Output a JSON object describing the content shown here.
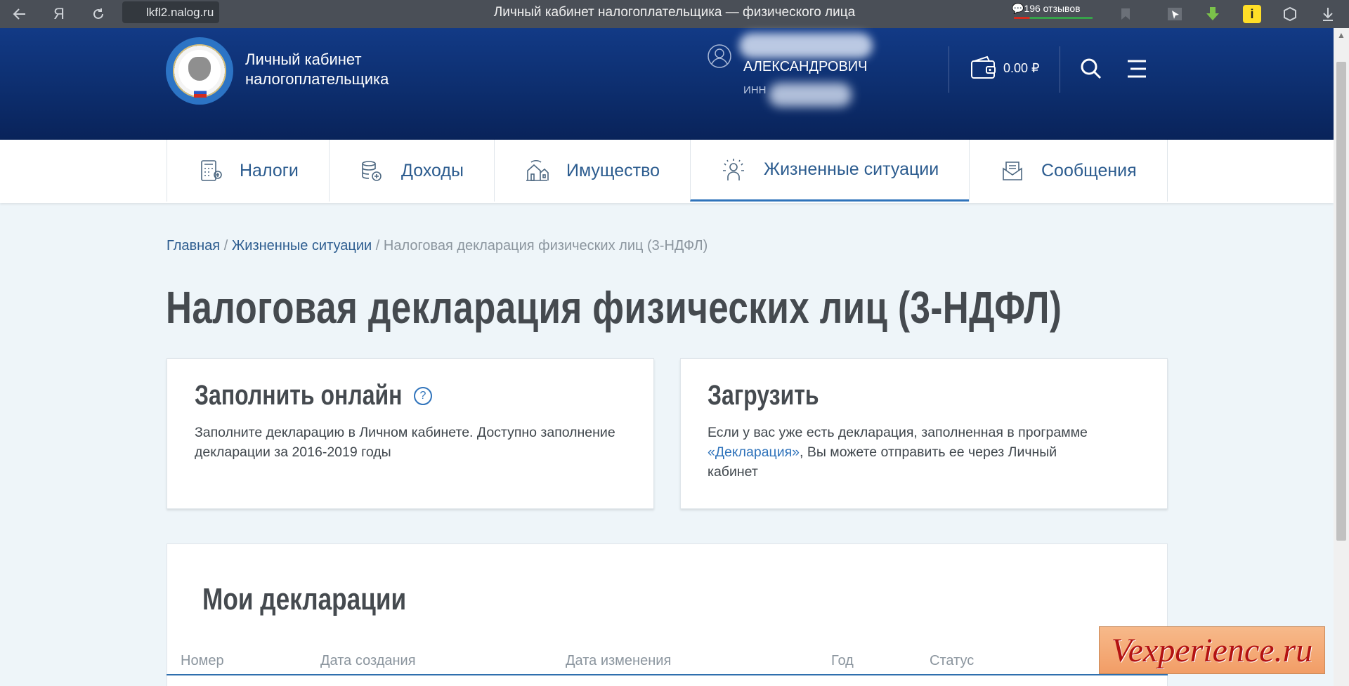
{
  "browser": {
    "host": "lkfl2.nalog.ru",
    "tab_title": "Личный кабинет налогоплательщика — физического лица",
    "reviews": "196 отзывов",
    "extension_badge": "i"
  },
  "header": {
    "cabinet_title_line1": "Личный кабинет",
    "cabinet_title_line2": "налогоплательщика",
    "user_name": "АЛЕКСАНДРОВИЧ",
    "user_inn_label": "ИНН",
    "balance": "0.00 ₽"
  },
  "nav": {
    "tabs": [
      {
        "label": "Налоги",
        "icon": "calculator-icon"
      },
      {
        "label": "Доходы",
        "icon": "coins-icon"
      },
      {
        "label": "Имущество",
        "icon": "house-icon"
      },
      {
        "label": "Жизненные ситуации",
        "icon": "people-icon",
        "active": true
      },
      {
        "label": "Сообщения",
        "icon": "envelope-icon"
      }
    ]
  },
  "breadcrumb": {
    "home": "Главная",
    "sep": "/",
    "section": "Жизненные ситуации",
    "current": "Налоговая декларация физических лиц (3-НДФЛ)"
  },
  "page": {
    "title": "Налоговая декларация физических лиц (3-НДФЛ)"
  },
  "cards": {
    "online": {
      "title": "Заполнить онлайн",
      "help": "?",
      "text": "Заполните декларацию в Личном кабинете. Доступно заполнение декларации за 2016-2019 годы"
    },
    "upload": {
      "title": "Загрузить",
      "text_before": "Если у вас уже есть декларация, заполненная в программе ",
      "link": "«Декларация»",
      "text_after": ", Вы можете отправить ее через Личный кабинет"
    }
  },
  "declarations": {
    "title": "Мои декларации",
    "columns": [
      "Номер",
      "Дата создания",
      "Дата изменения",
      "Год",
      "Статус"
    ]
  },
  "watermark": "Vexperience.ru",
  "colors": {
    "header_blue": "#0d2e6e",
    "link_blue": "#2c5c8f",
    "active_tab": "#2f73bb",
    "lock_green": "#26a641"
  }
}
